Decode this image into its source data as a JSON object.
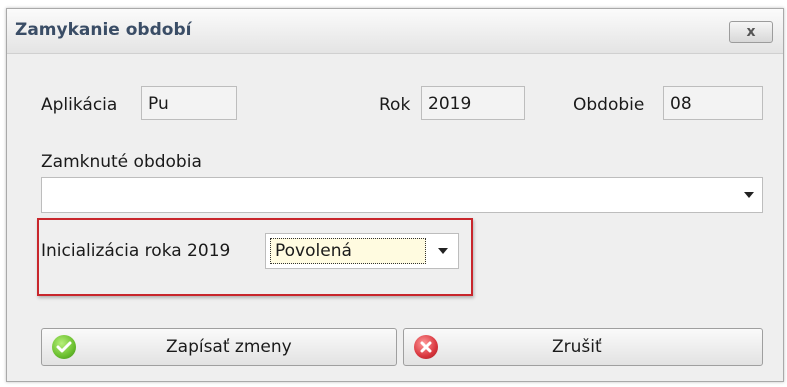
{
  "dialog": {
    "title": "Zamykanie období",
    "close_label": "x"
  },
  "fields": {
    "aplikacia_label": "Aplikácia",
    "aplikacia_value": "Pu",
    "rok_label": "Rok",
    "rok_value": "2019",
    "obdobie_label": "Obdobie",
    "obdobie_value": "08",
    "zamknute_label": "Zamknuté obdobia",
    "zamknute_value": ""
  },
  "init": {
    "label": "Inicializácia roka 2019",
    "selected": "Povolená"
  },
  "buttons": {
    "save_label": "Zapísať zmeny",
    "cancel_label": "Zrušiť"
  },
  "colors": {
    "highlight": "#c8262c",
    "save_icon": "#6abf2e",
    "cancel_icon": "#d9363e"
  },
  "icons": {
    "save": "check-circle-icon",
    "cancel": "x-circle-icon",
    "close": "close-icon",
    "dropdown": "chevron-down-icon"
  }
}
